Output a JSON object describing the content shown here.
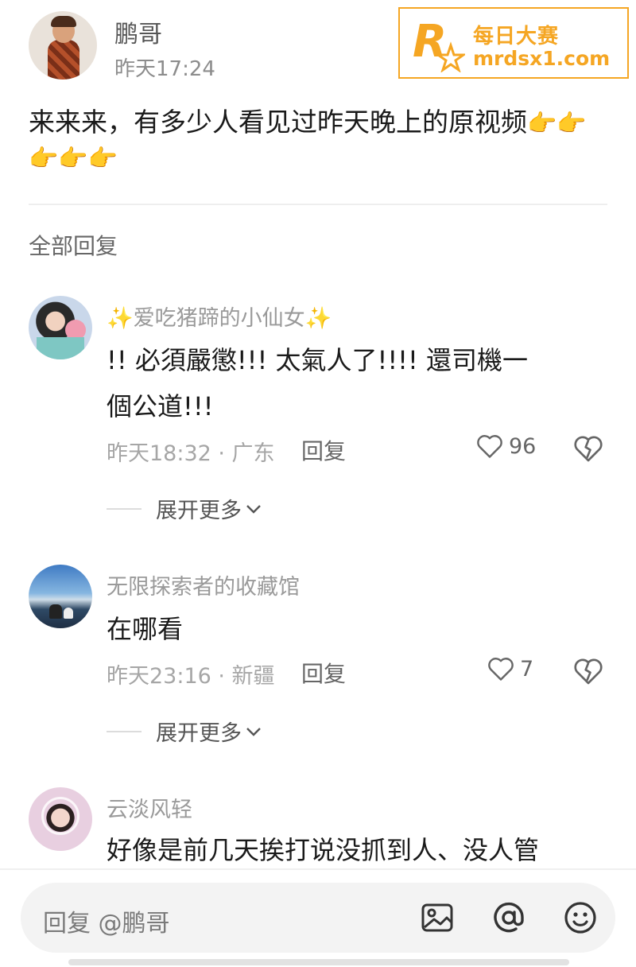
{
  "post": {
    "author": "鹏哥",
    "time": "昨天17:24",
    "content": "来来来，有多少人看见过昨天晚上的原视频",
    "emojis": [
      "👉",
      "👉",
      "👉",
      "👉",
      "👉"
    ]
  },
  "watermark": {
    "logo_letter": "R",
    "title": "每日大赛",
    "url": "mrdsx1.com",
    "color": "#f5a623"
  },
  "replies_header": "全部回复",
  "comments": [
    {
      "name": "✨爱吃猪蹄的小仙女✨",
      "text_line1": "!!  必須嚴懲!!!  太氣人了!!!!  還司機一",
      "text_line2": "個公道!!!",
      "meta": "昨天18:32 · 广东",
      "reply": "回复",
      "likes": "96",
      "expand": "展开更多"
    },
    {
      "name": "无限探索者的收藏馆",
      "text_line1": "在哪看",
      "meta": "昨天23:16 · 新疆",
      "reply": "回复",
      "likes": "7",
      "expand": "展开更多"
    },
    {
      "name": "云淡风轻",
      "text_line1": "好像是前几天挨打说没抓到人、没人管"
    }
  ],
  "reply_bar": {
    "placeholder": "回复 @鹏哥",
    "icons": [
      "image-icon",
      "at-icon",
      "emoji-icon"
    ]
  }
}
